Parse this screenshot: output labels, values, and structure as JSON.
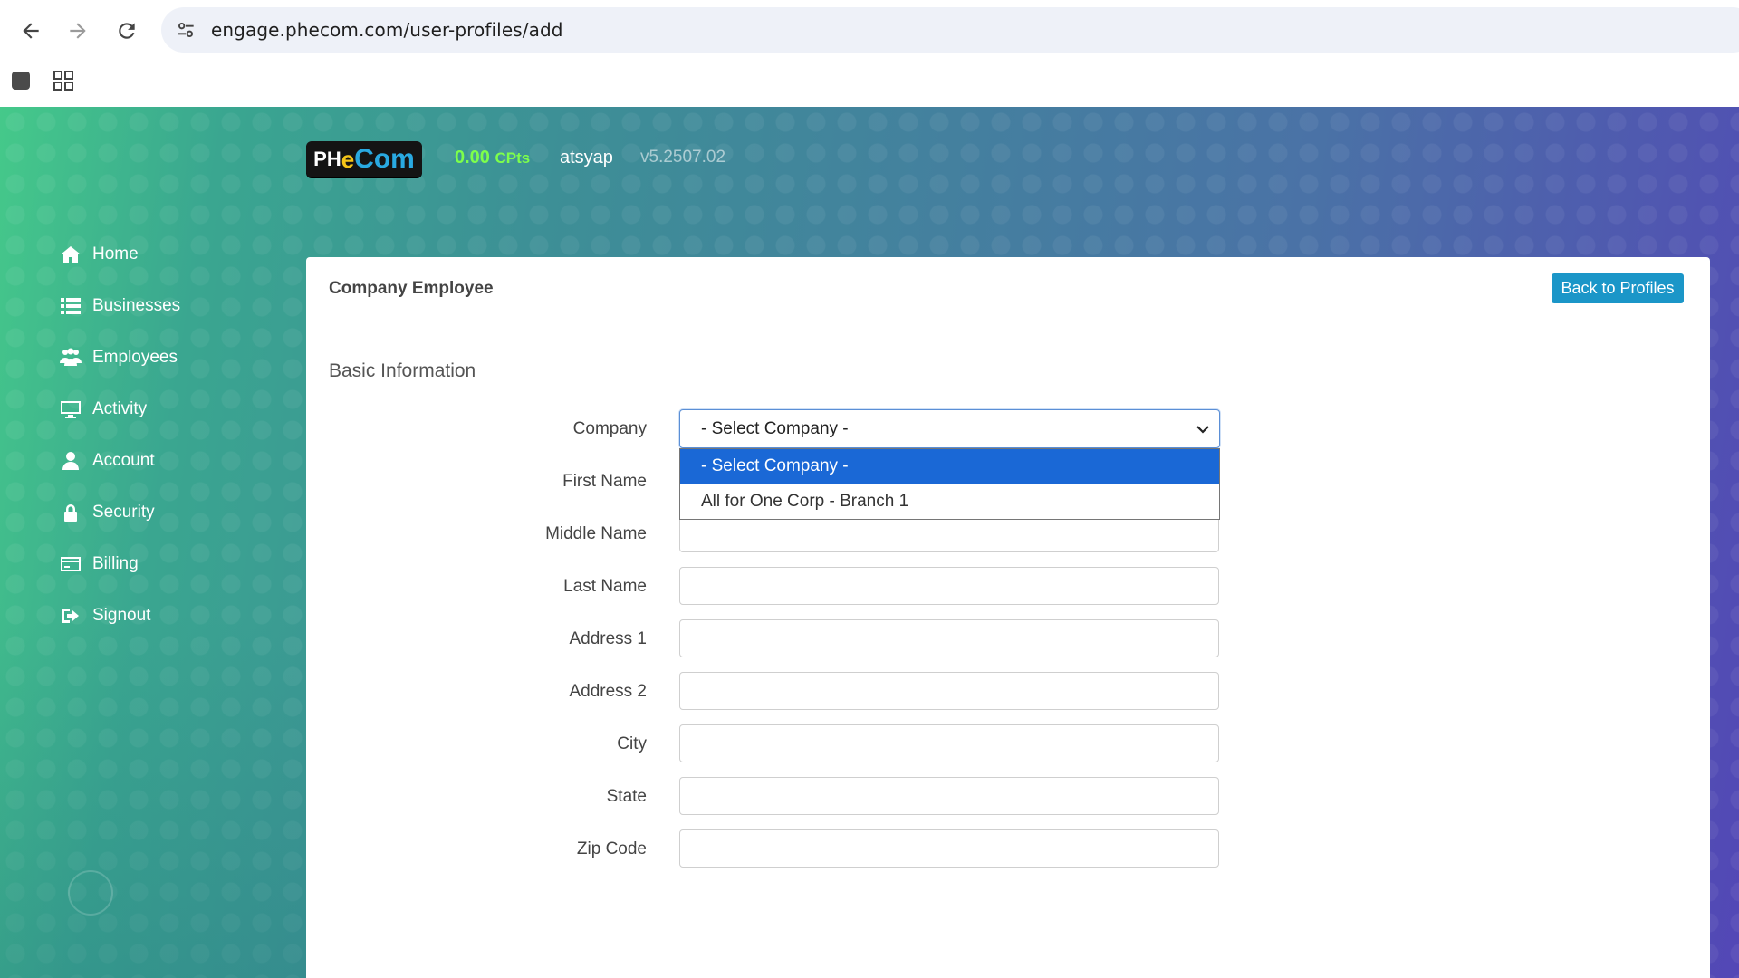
{
  "browser": {
    "url": "engage.phecom.com/user-profiles/add"
  },
  "header": {
    "logo": {
      "ph": "PH",
      "e": "e",
      "com": "Com"
    },
    "points_value": "0.00",
    "points_unit": "CPts",
    "username": "atsyap",
    "version": "v5.2507.02",
    "points_color": "#7dff4b"
  },
  "sidebar": {
    "items": [
      {
        "label": "Home",
        "icon": "home-icon"
      },
      {
        "label": "Businesses",
        "icon": "list-icon"
      },
      {
        "label": "Employees",
        "icon": "users-icon"
      },
      {
        "label": "Activity",
        "icon": "monitor-icon"
      },
      {
        "label": "Account",
        "icon": "user-icon"
      },
      {
        "label": "Security",
        "icon": "lock-icon"
      },
      {
        "label": "Billing",
        "icon": "credit-card-icon"
      },
      {
        "label": "Signout",
        "icon": "sign-out-icon"
      }
    ]
  },
  "card": {
    "title": "Company Employee",
    "back_button": "Back to Profiles",
    "section_title": "Basic Information",
    "accent_color": "#1b96c8"
  },
  "form": {
    "company_label": "Company",
    "company_selected": "- Select Company -",
    "company_options": [
      "- Select Company -",
      "All for One Corp - Branch 1"
    ],
    "first_name_label": "First Name",
    "middle_name_label": "Middle Name",
    "last_name_label": "Last Name",
    "address1_label": "Address 1",
    "address2_label": "Address 2",
    "city_label": "City",
    "state_label": "State",
    "zip_label": "Zip Code"
  }
}
